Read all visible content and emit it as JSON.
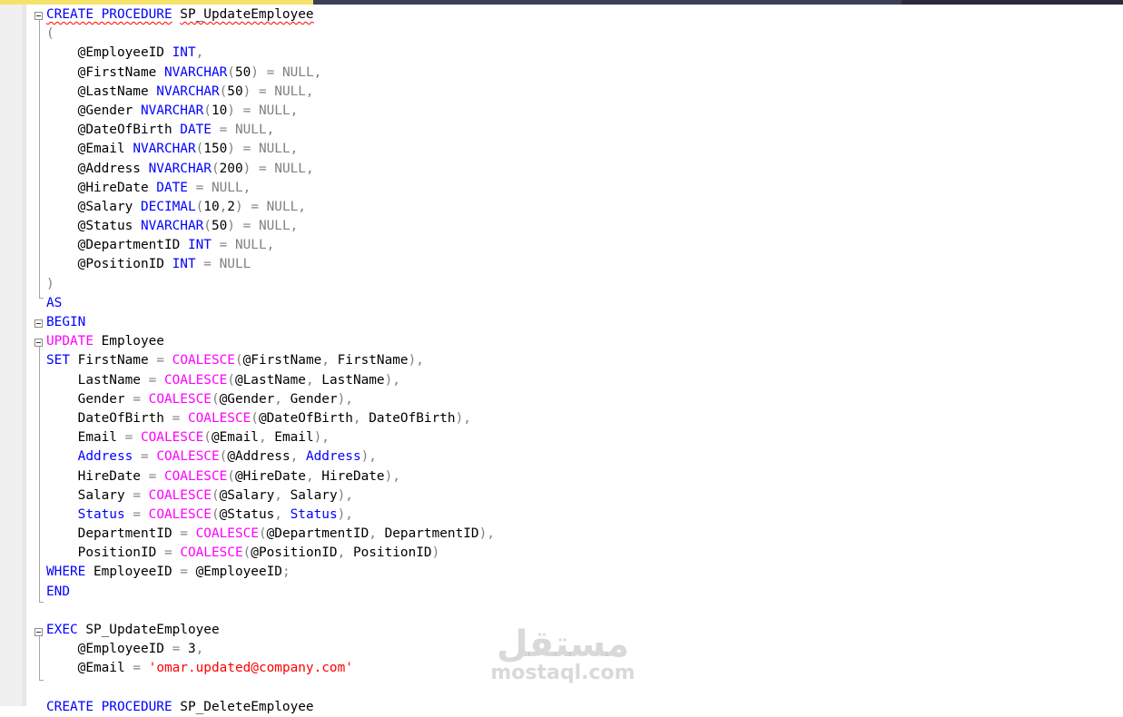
{
  "editor": {
    "lines": [
      [
        [
          "kw",
          "CREATE PROCEDURE",
          true
        ],
        [
          "t",
          " "
        ],
        [
          "t",
          "SP_UpdateEmployee",
          true
        ]
      ],
      [
        [
          "op",
          "("
        ]
      ],
      [
        [
          "t",
          "    @EmployeeID "
        ],
        [
          "kw",
          "INT"
        ],
        [
          "op",
          ","
        ]
      ],
      [
        [
          "t",
          "    @FirstName "
        ],
        [
          "kw",
          "NVARCHAR"
        ],
        [
          "op",
          "("
        ],
        [
          "t",
          "50"
        ],
        [
          "op",
          ")"
        ],
        [
          "t",
          " "
        ],
        [
          "op",
          "= NULL,"
        ]
      ],
      [
        [
          "t",
          "    @LastName "
        ],
        [
          "kw",
          "NVARCHAR"
        ],
        [
          "op",
          "("
        ],
        [
          "t",
          "50"
        ],
        [
          "op",
          ")"
        ],
        [
          "t",
          " "
        ],
        [
          "op",
          "= NULL,"
        ]
      ],
      [
        [
          "t",
          "    @Gender "
        ],
        [
          "kw",
          "NVARCHAR"
        ],
        [
          "op",
          "("
        ],
        [
          "t",
          "10"
        ],
        [
          "op",
          ")"
        ],
        [
          "t",
          " "
        ],
        [
          "op",
          "= NULL,"
        ]
      ],
      [
        [
          "t",
          "    @DateOfBirth "
        ],
        [
          "kw",
          "DATE"
        ],
        [
          "t",
          " "
        ],
        [
          "op",
          "= NULL,"
        ]
      ],
      [
        [
          "t",
          "    @Email "
        ],
        [
          "kw",
          "NVARCHAR"
        ],
        [
          "op",
          "("
        ],
        [
          "t",
          "150"
        ],
        [
          "op",
          ")"
        ],
        [
          "t",
          " "
        ],
        [
          "op",
          "= NULL,"
        ]
      ],
      [
        [
          "t",
          "    @Address "
        ],
        [
          "kw",
          "NVARCHAR"
        ],
        [
          "op",
          "("
        ],
        [
          "t",
          "200"
        ],
        [
          "op",
          ")"
        ],
        [
          "t",
          " "
        ],
        [
          "op",
          "= NULL,"
        ]
      ],
      [
        [
          "t",
          "    @HireDate "
        ],
        [
          "kw",
          "DATE"
        ],
        [
          "t",
          " "
        ],
        [
          "op",
          "= NULL,"
        ]
      ],
      [
        [
          "t",
          "    @Salary "
        ],
        [
          "kw",
          "DECIMAL"
        ],
        [
          "op",
          "("
        ],
        [
          "t",
          "10"
        ],
        [
          "op",
          ","
        ],
        [
          "t",
          "2"
        ],
        [
          "op",
          ")"
        ],
        [
          "t",
          " "
        ],
        [
          "op",
          "= NULL,"
        ]
      ],
      [
        [
          "t",
          "    @Status "
        ],
        [
          "kw",
          "NVARCHAR"
        ],
        [
          "op",
          "("
        ],
        [
          "t",
          "50"
        ],
        [
          "op",
          ")"
        ],
        [
          "t",
          " "
        ],
        [
          "op",
          "= NULL,"
        ]
      ],
      [
        [
          "t",
          "    @DepartmentID "
        ],
        [
          "kw",
          "INT"
        ],
        [
          "t",
          " "
        ],
        [
          "op",
          "= NULL,"
        ]
      ],
      [
        [
          "t",
          "    @PositionID "
        ],
        [
          "kw",
          "INT"
        ],
        [
          "t",
          " "
        ],
        [
          "op",
          "= NULL"
        ]
      ],
      [
        [
          "op",
          ")"
        ]
      ],
      [
        [
          "kw",
          "AS"
        ]
      ],
      [
        [
          "kw",
          "BEGIN"
        ]
      ],
      [
        [
          "fn",
          "UPDATE"
        ],
        [
          "t",
          " Employee"
        ]
      ],
      [
        [
          "kw",
          "SET"
        ],
        [
          "t",
          " FirstName "
        ],
        [
          "op",
          "="
        ],
        [
          "t",
          " "
        ],
        [
          "fn",
          "COALESCE"
        ],
        [
          "op",
          "("
        ],
        [
          "t",
          "@FirstName"
        ],
        [
          "op",
          ","
        ],
        [
          "t",
          " FirstName"
        ],
        [
          "op",
          "),"
        ]
      ],
      [
        [
          "t",
          "    LastName "
        ],
        [
          "op",
          "="
        ],
        [
          "t",
          " "
        ],
        [
          "fn",
          "COALESCE"
        ],
        [
          "op",
          "("
        ],
        [
          "t",
          "@LastName"
        ],
        [
          "op",
          ","
        ],
        [
          "t",
          " LastName"
        ],
        [
          "op",
          "),"
        ]
      ],
      [
        [
          "t",
          "    Gender "
        ],
        [
          "op",
          "="
        ],
        [
          "t",
          " "
        ],
        [
          "fn",
          "COALESCE"
        ],
        [
          "op",
          "("
        ],
        [
          "t",
          "@Gender"
        ],
        [
          "op",
          ","
        ],
        [
          "t",
          " Gender"
        ],
        [
          "op",
          "),"
        ]
      ],
      [
        [
          "t",
          "    DateOfBirth "
        ],
        [
          "op",
          "="
        ],
        [
          "t",
          " "
        ],
        [
          "fn",
          "COALESCE"
        ],
        [
          "op",
          "("
        ],
        [
          "t",
          "@DateOfBirth"
        ],
        [
          "op",
          ","
        ],
        [
          "t",
          " DateOfBirth"
        ],
        [
          "op",
          "),"
        ]
      ],
      [
        [
          "t",
          "    Email "
        ],
        [
          "op",
          "="
        ],
        [
          "t",
          " "
        ],
        [
          "fn",
          "COALESCE"
        ],
        [
          "op",
          "("
        ],
        [
          "t",
          "@Email"
        ],
        [
          "op",
          ","
        ],
        [
          "t",
          " Email"
        ],
        [
          "op",
          "),"
        ]
      ],
      [
        [
          "t",
          "    "
        ],
        [
          "kw",
          "Address"
        ],
        [
          "t",
          " "
        ],
        [
          "op",
          "="
        ],
        [
          "t",
          " "
        ],
        [
          "fn",
          "COALESCE"
        ],
        [
          "op",
          "("
        ],
        [
          "t",
          "@Address"
        ],
        [
          "op",
          ","
        ],
        [
          "t",
          " "
        ],
        [
          "kw",
          "Address"
        ],
        [
          "op",
          "),"
        ]
      ],
      [
        [
          "t",
          "    HireDate "
        ],
        [
          "op",
          "="
        ],
        [
          "t",
          " "
        ],
        [
          "fn",
          "COALESCE"
        ],
        [
          "op",
          "("
        ],
        [
          "t",
          "@HireDate"
        ],
        [
          "op",
          ","
        ],
        [
          "t",
          " HireDate"
        ],
        [
          "op",
          "),"
        ]
      ],
      [
        [
          "t",
          "    Salary "
        ],
        [
          "op",
          "="
        ],
        [
          "t",
          " "
        ],
        [
          "fn",
          "COALESCE"
        ],
        [
          "op",
          "("
        ],
        [
          "t",
          "@Salary"
        ],
        [
          "op",
          ","
        ],
        [
          "t",
          " Salary"
        ],
        [
          "op",
          "),"
        ]
      ],
      [
        [
          "t",
          "    "
        ],
        [
          "kw",
          "Status"
        ],
        [
          "t",
          " "
        ],
        [
          "op",
          "="
        ],
        [
          "t",
          " "
        ],
        [
          "fn",
          "COALESCE"
        ],
        [
          "op",
          "("
        ],
        [
          "t",
          "@Status"
        ],
        [
          "op",
          ","
        ],
        [
          "t",
          " "
        ],
        [
          "kw",
          "Status"
        ],
        [
          "op",
          "),"
        ]
      ],
      [
        [
          "t",
          "    DepartmentID "
        ],
        [
          "op",
          "="
        ],
        [
          "t",
          " "
        ],
        [
          "fn",
          "COALESCE"
        ],
        [
          "op",
          "("
        ],
        [
          "t",
          "@DepartmentID"
        ],
        [
          "op",
          ","
        ],
        [
          "t",
          " DepartmentID"
        ],
        [
          "op",
          "),"
        ]
      ],
      [
        [
          "t",
          "    PositionID "
        ],
        [
          "op",
          "="
        ],
        [
          "t",
          " "
        ],
        [
          "fn",
          "COALESCE"
        ],
        [
          "op",
          "("
        ],
        [
          "t",
          "@PositionID"
        ],
        [
          "op",
          ","
        ],
        [
          "t",
          " PositionID"
        ],
        [
          "op",
          ")"
        ]
      ],
      [
        [
          "kw",
          "WHERE"
        ],
        [
          "t",
          " EmployeeID "
        ],
        [
          "op",
          "="
        ],
        [
          "t",
          " @EmployeeID"
        ],
        [
          "op",
          ";"
        ]
      ],
      [
        [
          "kw",
          "END"
        ]
      ],
      [
        [
          "t",
          ""
        ]
      ],
      [
        [
          "kw",
          "EXEC"
        ],
        [
          "t",
          " SP_UpdateEmployee"
        ]
      ],
      [
        [
          "t",
          "    @EmployeeID "
        ],
        [
          "op",
          "="
        ],
        [
          "t",
          " 3"
        ],
        [
          "op",
          ","
        ]
      ],
      [
        [
          "t",
          "    @Email "
        ],
        [
          "op",
          "="
        ],
        [
          "t",
          " "
        ],
        [
          "str",
          "'omar.updated@company.com'"
        ]
      ],
      [
        [
          "t",
          ""
        ]
      ],
      [
        [
          "kw",
          "CREATE PROCEDURE"
        ],
        [
          "t",
          " SP_DeleteEmployee"
        ]
      ]
    ]
  },
  "watermark": {
    "arabic": "مستقل",
    "latin": "mostaql.com"
  },
  "colors": {
    "keyword": "#0000ff",
    "function": "#ff00ff",
    "operator": "#808080",
    "string": "#ff0000"
  }
}
